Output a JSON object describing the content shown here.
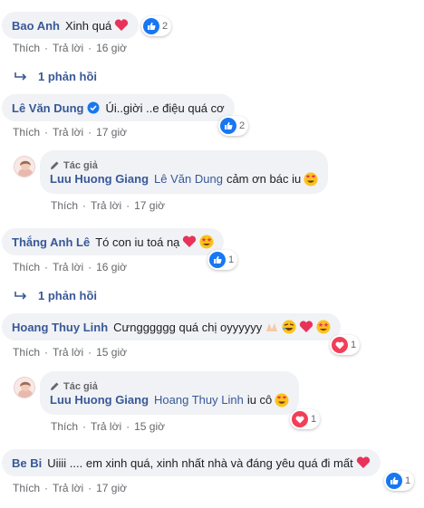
{
  "labels": {
    "like": "Thích",
    "reply": "Trả lời",
    "separator": "·",
    "author_badge": "Tác giả"
  },
  "comments": [
    {
      "author": "Bao Anh",
      "text": "Xinh quá",
      "reactions": "2",
      "time": "16 giờ",
      "reply_toggle": "1 phản hồi"
    },
    {
      "author": "Lê Văn Dung",
      "text": "Úi..giời ..e điệu quá cơ",
      "reactions": "2",
      "time": "17 giờ",
      "reply": {
        "author": "Luu Huong Giang",
        "mention": "Lê Văn Dung",
        "text": "cảm ơn bác iu",
        "time": "17 giờ"
      }
    },
    {
      "author": "Thắng Anh Lê",
      "text": "Tó con iu toá nạ",
      "reactions": "1",
      "time": "16 giờ",
      "reply_toggle": "1 phản hồi"
    },
    {
      "author": "Hoang Thuy Linh",
      "text": "Cưngggggg quá chị oyyyyyy",
      "reactions": "1",
      "time": "15 giờ",
      "reply": {
        "author": "Luu Huong Giang",
        "mention": "Hoang Thuy Linh",
        "text": "iu cô",
        "reactions": "1",
        "time": "15 giờ"
      }
    },
    {
      "author": "Be Bi",
      "text": "Uiiii .... em xinh quá, xinh nhất nhà và đáng yêu quá đi mất",
      "reactions": "1",
      "time": "17 giờ"
    }
  ],
  "icons": [
    "like-icon",
    "love-icon",
    "verified-badge-icon",
    "pencil-icon",
    "reply-arrow-icon",
    "heart-eyes-emoji",
    "star-struck-emoji",
    "heart-emoji",
    "rofl-emoji",
    "pray-emoji",
    "smiling-hearts-emoji"
  ],
  "colors": {
    "link": "#385898",
    "bubble": "#f0f2f5",
    "meta": "#65676b",
    "like": "#1877f2",
    "love": "#f33e58"
  }
}
